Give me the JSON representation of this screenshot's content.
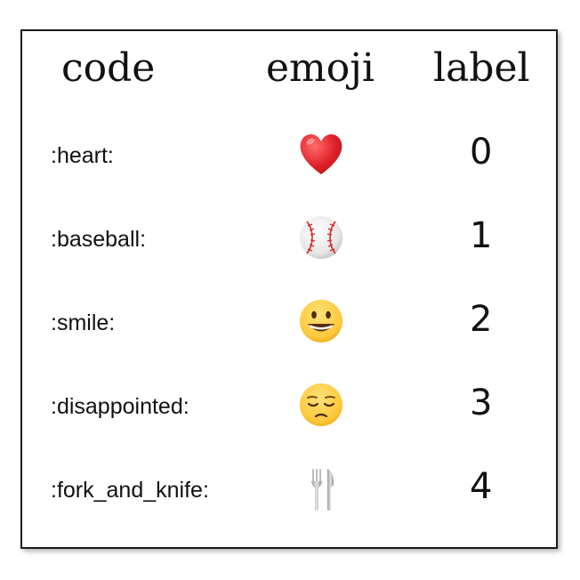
{
  "header": {
    "code": "code",
    "emoji": "emoji",
    "label": "label"
  },
  "rows": [
    {
      "code": ":heart:",
      "emoji": "heart-icon",
      "label": "0"
    },
    {
      "code": ":baseball:",
      "emoji": "baseball-icon",
      "label": "1"
    },
    {
      "code": ":smile:",
      "emoji": "smile-icon",
      "label": "2"
    },
    {
      "code": ":disappointed:",
      "emoji": "disappointed-face-icon",
      "label": "3"
    },
    {
      "code": ":fork_and_knife:",
      "emoji": "fork-and-knife-icon",
      "label": "4"
    }
  ],
  "colors": {
    "heart": "#e0222a",
    "face": "#fdc93b",
    "baseball_stitch": "#d22b2b",
    "border": "#1a1a1a"
  }
}
